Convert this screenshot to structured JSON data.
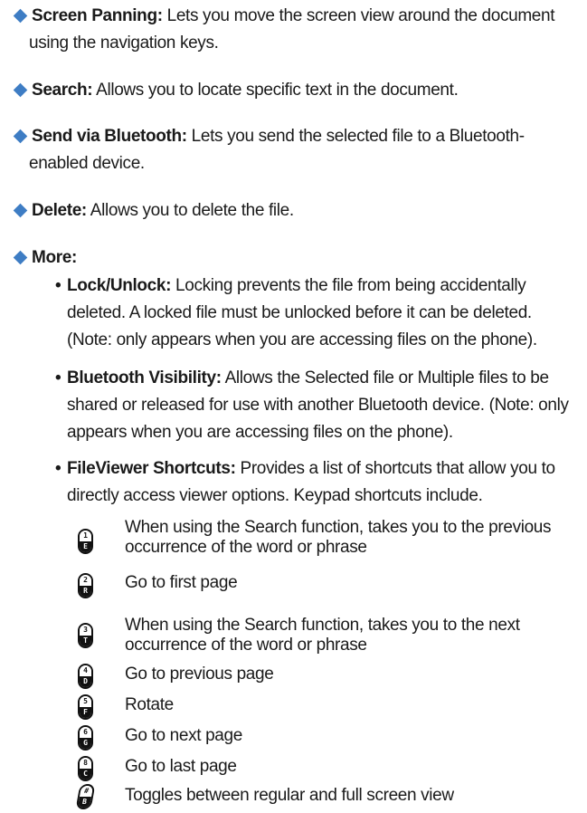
{
  "items": [
    {
      "term": "Screen Panning:",
      "text": " Lets you move the screen view around the document",
      "cont": "using the navigation keys."
    },
    {
      "term": "Search:",
      "text": " Allows you to locate specific text in the document."
    },
    {
      "term": "Send via Bluetooth:",
      "text": " Lets you send the selected file to a Bluetooth-",
      "cont": "enabled device."
    },
    {
      "term": "Delete:",
      "text": " Allows you to delete the file."
    },
    {
      "term": "More:"
    }
  ],
  "subitems": [
    {
      "bullet": "•",
      "term": "Lock/Unlock:",
      "text": " Locking prevents the file from being accidentally deleted. A locked file must be unlocked before it can be deleted. (Note: only appears when you are accessing files on the phone)."
    },
    {
      "bullet": "•",
      "term": "Bluetooth Visibility:",
      "text": " Allows the Selected file or Multiple files to be shared or released for use with another Bluetooth device. (Note: only appears when you are accessing files on the phone)."
    },
    {
      "bullet": "•",
      "term": "FileViewer Shortcuts:",
      "text": " Provides a list of shortcuts that allow you to directly access viewer options. Keypad shortcuts include."
    }
  ],
  "shortcuts": [
    {
      "key_top": "1",
      "key_bottom": "E",
      "desc": "When using the Search function, takes you to the previous occurrence of the word or phrase"
    },
    {
      "key_top": "2",
      "key_bottom": "R",
      "desc": "Go to first page"
    },
    {
      "key_top": "3",
      "key_bottom": "T",
      "desc": "When using the Search function, takes you to the next occurrence of the word or phrase"
    },
    {
      "key_top": "4",
      "key_bottom": "D",
      "desc": "Go to previous page"
    },
    {
      "key_top": "5",
      "key_bottom": "F",
      "desc": "Rotate"
    },
    {
      "key_top": "6",
      "key_bottom": "G",
      "desc": "Go to next page"
    },
    {
      "key_top": "8",
      "key_bottom": "C",
      "desc": "Go to last page"
    },
    {
      "key_top": "#",
      "key_bottom": "B",
      "desc": "Toggles between regular and full screen view"
    }
  ],
  "colors": {
    "diamond": "#3e7dc4",
    "text": "#1a1a1a"
  }
}
